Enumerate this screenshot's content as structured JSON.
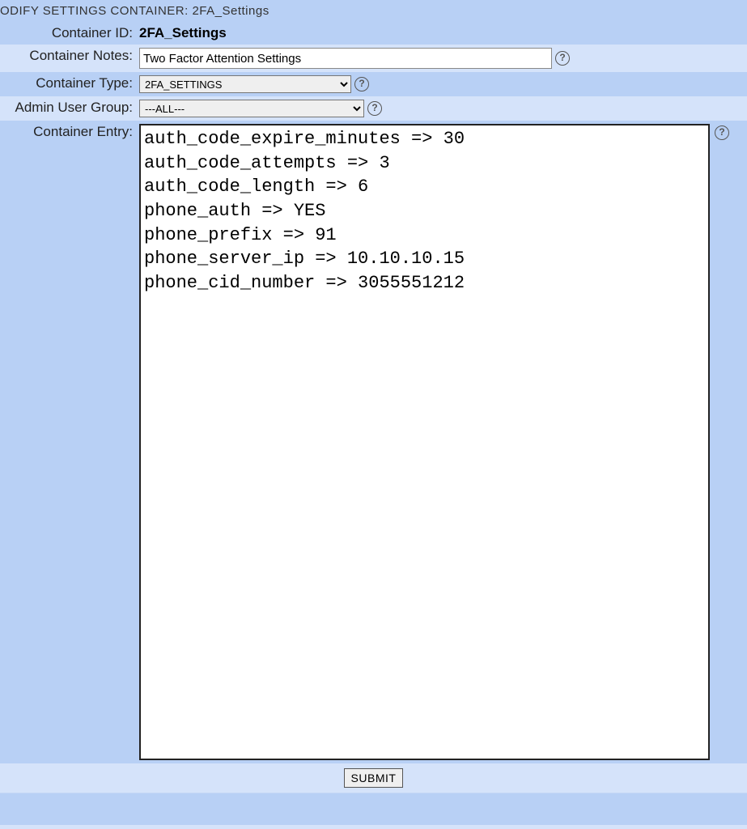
{
  "header": {
    "title_prefix": "ODIFY SETTINGS CONTAINER: ",
    "title_value": "2FA_Settings"
  },
  "form": {
    "labels": {
      "container_id": "Container ID:",
      "container_notes": "Container Notes:",
      "container_type": "Container Type:",
      "admin_user_group": "Admin User Group:",
      "container_entry": "Container Entry:"
    },
    "container_id": "2FA_Settings",
    "container_notes": "Two Factor Attention Settings",
    "container_type_selected": "2FA_SETTINGS",
    "admin_user_group_selected": "---ALL---",
    "container_entry": "auth_code_expire_minutes => 30\nauth_code_attempts => 3\nauth_code_length => 6\nphone_auth => YES\nphone_prefix => 91\nphone_server_ip => 10.10.10.15\nphone_cid_number => 3055551212"
  },
  "buttons": {
    "submit": "SUBMIT"
  },
  "icons": {
    "help": "?"
  }
}
